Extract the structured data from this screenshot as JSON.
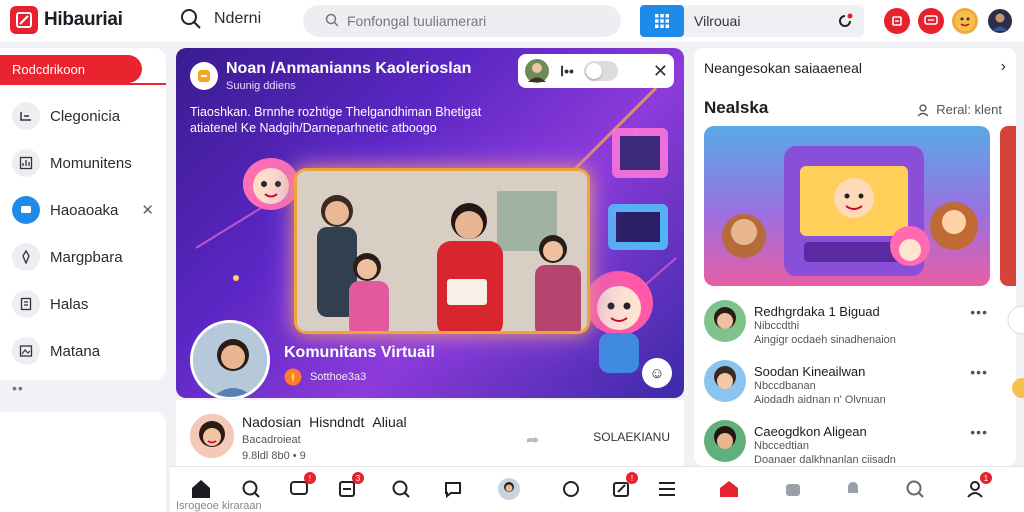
{
  "app": {
    "name": "Hibauriai"
  },
  "topbar": {
    "search_label": "Nderni",
    "search_placeholder": "Fonfongal tuuliamerari",
    "virtual_tab": "Vilrouai"
  },
  "sidebar": {
    "active_label": "Rodcdrikoon",
    "items": [
      {
        "label": "Clegonicia"
      },
      {
        "label": "Momunitens"
      },
      {
        "label": "Haoaoaka"
      },
      {
        "label": "Margpbara"
      },
      {
        "label": "Halas"
      },
      {
        "label": "Matana"
      }
    ],
    "more": "••"
  },
  "hero": {
    "title": "Noan /Anmanianns Kaolerioslan",
    "subtitle": "Suunig ddiens",
    "description": "Tiaoshkan. Brnnhe rozhtige Thelgandhiman Bhetigat atiatenel Ke Nadgih/Darneparhnetic atboogo",
    "footer_title": "Komunitans Virtuail",
    "footer_sub": "Sotthoe3a3",
    "toggle_dots": "Ⅰ••"
  },
  "feed": {
    "name": "Nadosian",
    "name2": "Hisndndt",
    "name3": "Aliual",
    "meta": "Bacadroieat",
    "meta2": "9.8ldl 8b0 • 9",
    "right_label": "SOLAEKIANU"
  },
  "right_panel": {
    "header": "Neangesokan saiaaeneal",
    "title": "Nealska",
    "link": "Reral: klent",
    "items": [
      {
        "name": "Redhgrdaka 1 Biguad",
        "sub": "Nibccdthi",
        "sub2": "Aingigr ocdaeh sinadhenaion"
      },
      {
        "name": "Soodan Kineailwan",
        "sub": "Nbccdbanan",
        "sub2": "Aiodadh aidnan n' Olvnuan"
      },
      {
        "name": "Caeogdkon Aligean",
        "sub": "Nbccedtian",
        "sub2": "Doanaer dalkhnanlan ciisadn"
      }
    ]
  },
  "bottom": {
    "strip": "Isrogeoe kiraraan"
  },
  "colors": {
    "brand_red": "#e8212f",
    "accent_blue": "#1e8be9",
    "hero_purple": "#5b27c4"
  }
}
